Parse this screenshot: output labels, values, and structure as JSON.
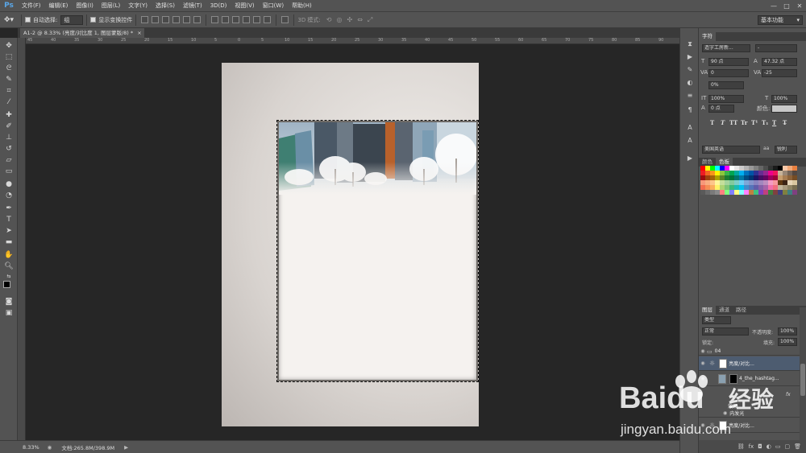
{
  "app": {
    "logo": "Ps",
    "menu": [
      "文件(F)",
      "编辑(E)",
      "图像(I)",
      "图层(L)",
      "文字(Y)",
      "选择(S)",
      "滤镜(T)",
      "3D(D)",
      "视图(V)",
      "窗口(W)",
      "帮助(H)"
    ],
    "window_controls": [
      "—",
      "□",
      "✕"
    ]
  },
  "options_bar": {
    "auto_select_label": "自动选择:",
    "auto_select_value": "组",
    "show_transform_label": "显示变换控件",
    "mode_3d_label": "3D 模式:",
    "workspace": "基本功能"
  },
  "document": {
    "tab_title": "A1-2 @ 8.33% (亮度/对比度 1, 图层蒙版/8) *",
    "close_glyph": "×",
    "ruler_ticks": [
      "45",
      "40",
      "35",
      "30",
      "25",
      "20",
      "15",
      "10",
      "5",
      "0",
      "5",
      "10",
      "15",
      "20",
      "25",
      "30",
      "35",
      "40",
      "45",
      "50",
      "55",
      "60",
      "65",
      "70",
      "75",
      "80",
      "85",
      "90"
    ]
  },
  "status_bar": {
    "zoom": "8.33%",
    "doc_info": "文档:265.8M/398.9M"
  },
  "character_panel": {
    "tab_label": "字符",
    "font_family": "造字工房新...",
    "font_style": "-",
    "font_size": "90 点",
    "leading": "47.32 点",
    "kerning": "0",
    "tracking": "-25",
    "vertical_scale_label": "0%",
    "scale_h": "100%",
    "scale_v": "100%",
    "baseline": "0 点",
    "color_label": "颜色:",
    "language": "美国英语",
    "antialias_icon": "aa",
    "antialias": "锐利",
    "format_buttons": [
      "T",
      "T",
      "TT",
      "Tr",
      "T¹",
      "T₁",
      "T",
      "T̶"
    ]
  },
  "swatches_panel": {
    "tabs": [
      "颜色",
      "色板"
    ],
    "colors": [
      "#ff0000",
      "#ffff00",
      "#00ff00",
      "#00ffff",
      "#0000ff",
      "#ff00ff",
      "#ffffff",
      "#e6e6e6",
      "#cccccc",
      "#b3b3b3",
      "#999999",
      "#808080",
      "#666666",
      "#4d4d4d",
      "#333333",
      "#1a1a1a",
      "#000000",
      "#f8c8a8",
      "#f0a878",
      "#e88040",
      "#ed1c24",
      "#f26522",
      "#f7941d",
      "#fff200",
      "#8dc63f",
      "#39b54a",
      "#00a651",
      "#00a99d",
      "#00aeef",
      "#0072bc",
      "#0054a6",
      "#2e3192",
      "#662d91",
      "#92278f",
      "#ec008c",
      "#ed145b",
      "#c7b299",
      "#998675",
      "#736357",
      "#534741",
      "#9e0b0f",
      "#a0410d",
      "#a36209",
      "#aba000",
      "#598527",
      "#1a7b30",
      "#007236",
      "#00746b",
      "#0076a3",
      "#004b80",
      "#003471",
      "#1b1464",
      "#440e62",
      "#630460",
      "#9e005d",
      "#9e0039",
      "#c69c6d",
      "#a67c52",
      "#8c6239",
      "#754c24",
      "#f7977a",
      "#f9ad81",
      "#fdc68a",
      "#fff79a",
      "#c4df9b",
      "#a3d39c",
      "#82ca9d",
      "#7bcdc8",
      "#6ecff6",
      "#7ea7d8",
      "#8493ca",
      "#8882be",
      "#a187be",
      "#bc8dbf",
      "#f49ac2",
      "#f6989d",
      "#603913",
      "#3c2415",
      "#e6d5b8",
      "#d8c6a0",
      "#f26c4f",
      "#f68e55",
      "#fbaf5c",
      "#fff467",
      "#acd372",
      "#7cc576",
      "#3bb878",
      "#1abbb4",
      "#00bff3",
      "#438cca",
      "#5574b9",
      "#605ca8",
      "#855fa8",
      "#a763a8",
      "#f06eaa",
      "#f26d7d",
      "#c2b59b",
      "#a99b7f",
      "#8f8466",
      "#766c50",
      "#5a5a5a",
      "#6a6a6a",
      "#7a7a7a",
      "#8a8a8a",
      "#ff8080",
      "#80ff80",
      "#8080ff",
      "#ffff80",
      "#80ffff",
      "#ff80ff",
      "#c08040",
      "#40c080",
      "#8040c0",
      "#c04080",
      "#408040",
      "#804040",
      "#404080",
      "#808040",
      "#408080",
      "#804080"
    ]
  },
  "layers_panel": {
    "tabs": [
      "图层",
      "通道",
      "路径"
    ],
    "filter_label": "类型",
    "blend_mode": "正常",
    "opacity_label": "不透明度:",
    "opacity_value": "100%",
    "lock_label": "锁定:",
    "fill_label": "填充:",
    "fill_value": "100%",
    "layers": [
      {
        "name": "04",
        "type": "group"
      },
      {
        "name": "亮度/对比...",
        "type": "adjustment",
        "selected": true
      },
      {
        "name": "4_the_hashtag...",
        "type": "image",
        "fx": "fx"
      },
      {
        "name": "效果",
        "type": "effect"
      },
      {
        "name": "内发光",
        "type": "effect"
      },
      {
        "name": "亮度/对比...",
        "type": "adjustment"
      }
    ]
  },
  "watermark": {
    "brand": "Baidu",
    "cn": "经验",
    "url": "jingyan.baidu.com"
  }
}
